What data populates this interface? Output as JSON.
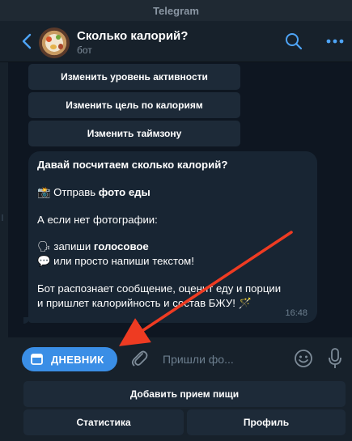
{
  "window": {
    "title": "Telegram"
  },
  "header": {
    "chat_name": "Сколько калорий?",
    "status": "бот"
  },
  "inline_keyboard": [
    "Изменить уровень активности",
    "Изменить цель по калориям",
    "Изменить таймзону"
  ],
  "message": {
    "heading": "Давай посчитаем сколько калорий?",
    "photo_emoji": "📸",
    "photo_prefix": "Отправь ",
    "photo_bold": "фото еды",
    "no_photo": "А если нет фотографии:",
    "voice_emoji": "🗣",
    "voice_prefix": "запиши ",
    "voice_bold": "голосовое",
    "text_emoji": "💬",
    "text_line": "или просто напиши текстом!",
    "result_line1": "Бот распознает сообщение, оценит еду и порции",
    "result_line2": "и пришлет калорийность и состав БЖУ! 🪄",
    "time": "16:48"
  },
  "composer": {
    "menu_label": "ДНЕВНИК",
    "placeholder": "Пришли фо..."
  },
  "reply_keyboard": {
    "row1": [
      "Добавить прием пищи"
    ],
    "row2": [
      "Статистика",
      "Профиль"
    ]
  },
  "colors": {
    "accent": "#3a8ee6",
    "annotation_arrow": "#ee3b22"
  }
}
